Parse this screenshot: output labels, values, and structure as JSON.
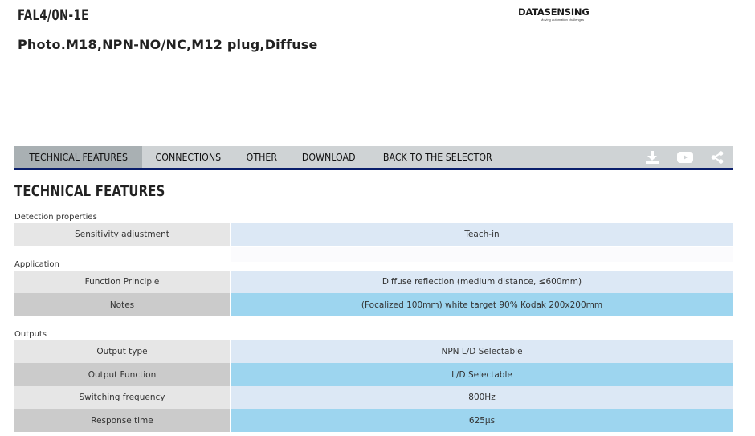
{
  "product": {
    "code": "FAL4/0N-1E",
    "title": "Photo.M18,NPN-NO/NC,M12 plug,Diffuse"
  },
  "logo": {
    "text": "DATASENSING",
    "tagline": "Moving automation challenges"
  },
  "tabs": [
    {
      "label": "TECHNICAL FEATURES",
      "active": true
    },
    {
      "label": "CONNECTIONS",
      "active": false
    },
    {
      "label": "OTHER",
      "active": false
    },
    {
      "label": "DOWNLOAD",
      "active": false
    },
    {
      "label": "BACK TO THE SELECTOR",
      "active": false
    }
  ],
  "tab_icons": [
    "download-icon",
    "video-icon",
    "share-icon"
  ],
  "section_title": "TECHNICAL FEATURES",
  "groups": [
    {
      "label": "Detection properties",
      "rows": [
        {
          "key": "Sensitivity adjustment",
          "value": "Teach-in"
        }
      ]
    },
    {
      "label": "Application",
      "rows": [
        {
          "key": "Function Principle",
          "value": "Diffuse reflection (medium distance, ≤600mm)"
        },
        {
          "key": "Notes",
          "value": "(Focalized 100mm) white target 90% Kodak 200x200mm"
        }
      ]
    },
    {
      "label": "Outputs",
      "rows": [
        {
          "key": "Output type",
          "value": "NPN L/D Selectable"
        },
        {
          "key": "Output Function",
          "value": "L/D Selectable"
        },
        {
          "key": "Switching frequency",
          "value": "800Hz"
        },
        {
          "key": "Response time",
          "value": "625µs"
        }
      ]
    }
  ],
  "colors": {
    "tabbar": "#cfd3d5",
    "tab_active": "#a9b0b3",
    "tab_underline": "#0a1e6b",
    "value_light": "#dce8f5",
    "value_blue": "#9dd5ef"
  }
}
